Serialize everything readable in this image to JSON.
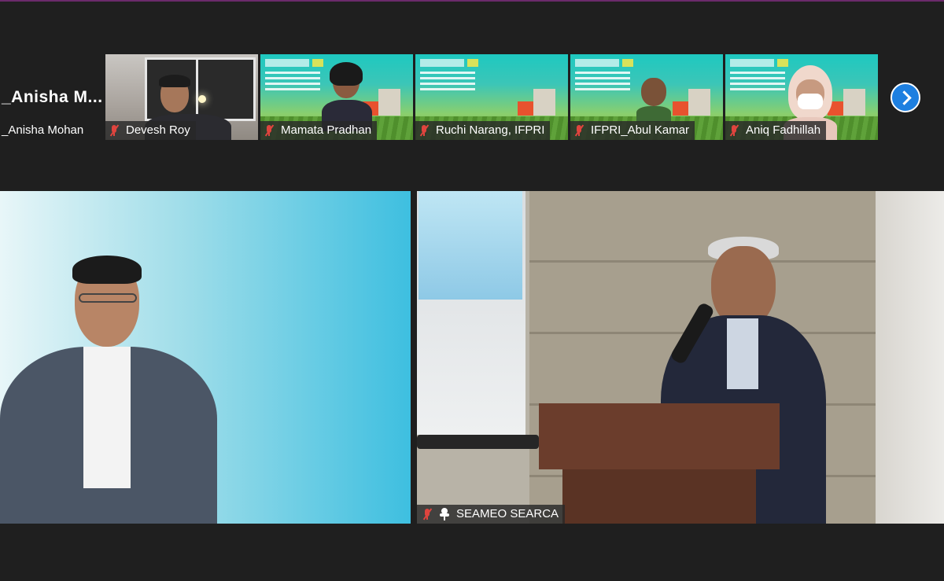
{
  "filmstrip": {
    "first_tile_big_name": "_Anisha  M...",
    "participants": [
      {
        "name": "_Anisha Mohan",
        "muted": false
      },
      {
        "name": "Devesh Roy",
        "muted": true
      },
      {
        "name": "Mamata Pradhan",
        "muted": true
      },
      {
        "name": "Ruchi Narang, IFPRI",
        "muted": true
      },
      {
        "name": "IFPRI_Abul Kamar",
        "muted": true
      },
      {
        "name": "Aniq Fadhillah",
        "muted": true
      }
    ],
    "next_button_icon": "chevron-right-icon"
  },
  "main": {
    "speaker_label": "SEAMEO SEARCA"
  },
  "colors": {
    "accent": "#1d7fe0",
    "muted_icon": "#e0443e",
    "background": "#1f1f1f"
  }
}
